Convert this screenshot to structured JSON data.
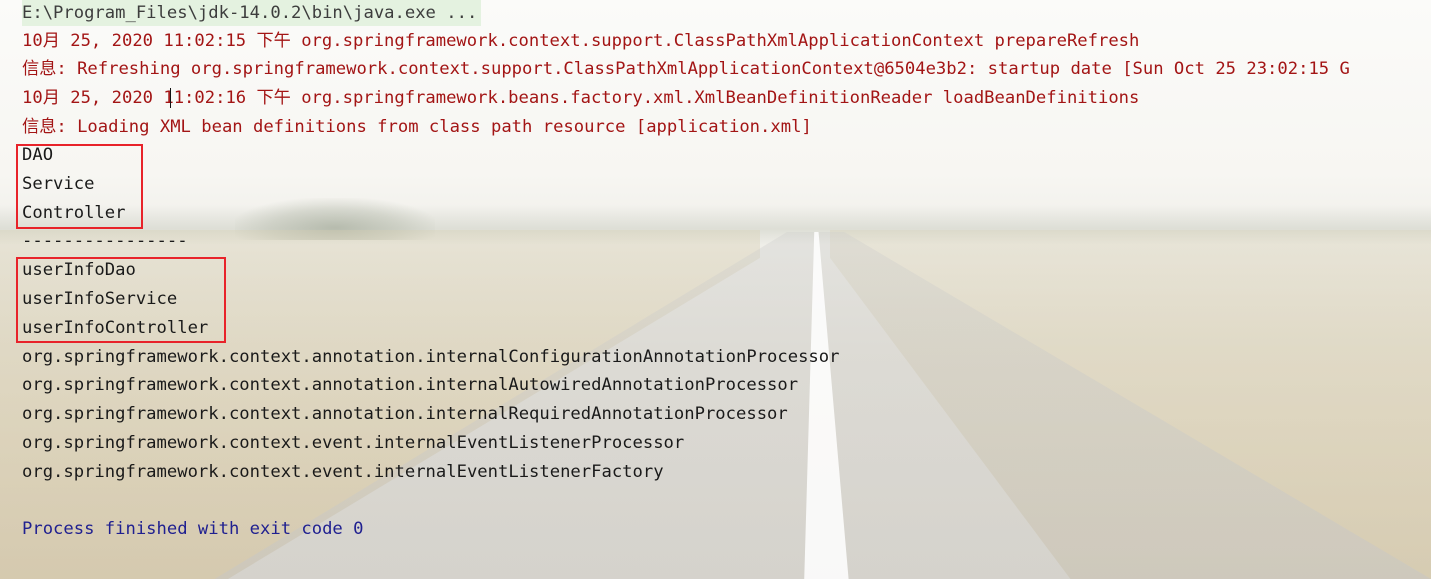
{
  "console": {
    "command_line": "E:\\Program_Files\\jdk-14.0.2\\bin\\java.exe ...",
    "log_lines": [
      "10月 25, 2020 11:02:15 下午 org.springframework.context.support.ClassPathXmlApplicationContext prepareRefresh",
      "信息: Refreshing org.springframework.context.support.ClassPathXmlApplicationContext@6504e3b2: startup date [Sun Oct 25 23:02:15 G",
      "10月 25, 2020 11:02:16 下午 org.springframework.beans.factory.xml.XmlBeanDefinitionReader loadBeanDefinitions",
      "信息: Loading XML bean definitions from class path resource [application.xml]"
    ],
    "group1": [
      "DAO",
      "Service",
      "Controller"
    ],
    "separator": "----------------",
    "group2": [
      "userInfoDao",
      "userInfoService",
      "userInfoController"
    ],
    "bean_names": [
      "org.springframework.context.annotation.internalConfigurationAnnotationProcessor",
      "org.springframework.context.annotation.internalAutowiredAnnotationProcessor",
      "org.springframework.context.annotation.internalRequiredAnnotationProcessor",
      "org.springframework.context.event.internalEventListenerProcessor",
      "org.springframework.context.event.internalEventListenerFactory"
    ],
    "exit_message": "Process finished with exit code 0"
  },
  "colors": {
    "log_text": "#a31515",
    "output_text": "#1a1a1a",
    "exit_text": "#202090",
    "highlight_box": "#e8232a"
  }
}
